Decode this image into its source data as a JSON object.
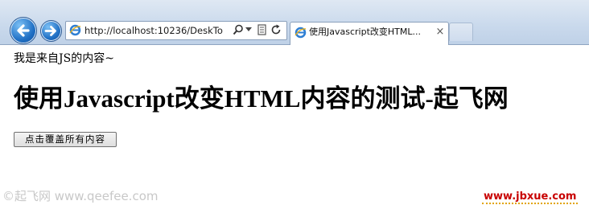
{
  "browser": {
    "address_url": "http://localhost:10236/DeskTo",
    "tab_title": "使用Javascript改变HTML...",
    "tab_close": "×",
    "colors": {
      "nav_button": "#1f6fc4",
      "chrome": "#c9d9ec"
    },
    "icons": [
      "back-arrow-icon",
      "forward-arrow-icon",
      "ie-logo-icon",
      "search-icon",
      "dropdown-icon",
      "compatibility-icon",
      "refresh-icon"
    ]
  },
  "page": {
    "js_text": "我是来自JS的内容~",
    "heading": "使用Javascript改变HTML内容的测试-起飞网",
    "button_label": "点击覆盖所有内容"
  },
  "watermarks": {
    "left": "©起飞网 www.qeefee.com",
    "right": "www.jbxue.com"
  }
}
